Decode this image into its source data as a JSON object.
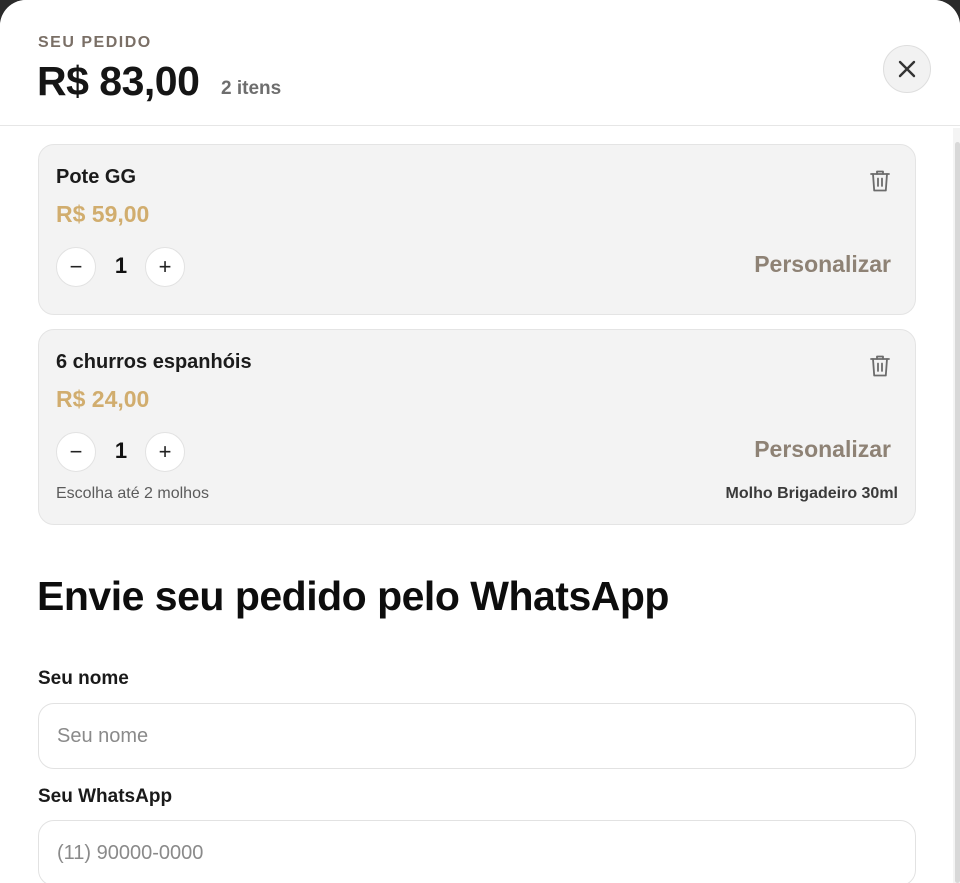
{
  "header": {
    "eyebrow": "SEU PEDIDO",
    "total": "R$ 83,00",
    "count": "2 itens",
    "close_icon": "close-icon"
  },
  "items": [
    {
      "name": "Pote GG",
      "price": "R$ 59,00",
      "qty": "1",
      "minus": "−",
      "plus": "+",
      "personalize": "Personalizar"
    },
    {
      "name": "6 churros espanhóis",
      "price": "R$ 24,00",
      "qty": "1",
      "minus": "−",
      "plus": "+",
      "personalize": "Personalizar",
      "sauce_hint": "Escolha até 2 molhos",
      "sauce_selected": "Molho Brigadeiro 30ml"
    }
  ],
  "form": {
    "title": "Envie seu pedido pelo WhatsApp",
    "name_label": "Seu nome",
    "name_placeholder": "Seu nome",
    "name_value": "",
    "whatsapp_label": "Seu WhatsApp",
    "whatsapp_placeholder": "(11) 90000-0000",
    "whatsapp_value": ""
  },
  "colors": {
    "accent_price": "#d1ad6e",
    "personalize": "#8e8275",
    "eyebrow": "#7a6f66"
  }
}
